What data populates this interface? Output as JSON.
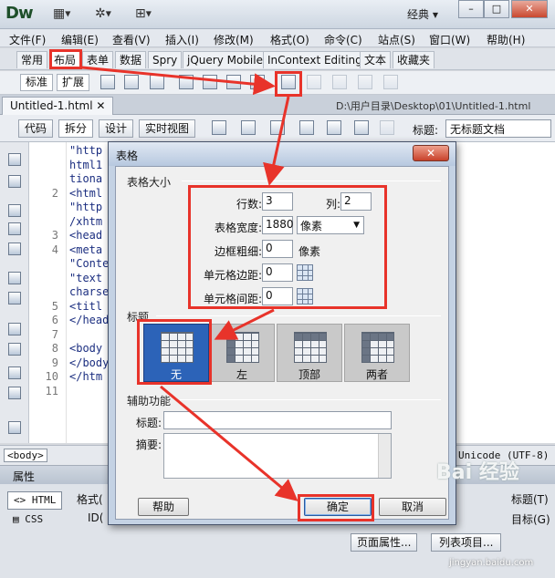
{
  "app": {
    "logo": "Dw",
    "workspace": "经典",
    "window_controls": [
      "–",
      "□",
      "✕"
    ]
  },
  "menu": [
    "文件(F)",
    "编辑(E)",
    "查看(V)",
    "插入(I)",
    "修改(M)",
    "格式(O)",
    "命令(C)",
    "站点(S)",
    "窗口(W)",
    "帮助(H)"
  ],
  "insert_tabs": [
    "常用",
    "布局",
    "表单",
    "数据",
    "Spry",
    "jQuery Mobile",
    "InContext Editing",
    "文本",
    "收藏夹"
  ],
  "insert_tools": {
    "standard": "标准",
    "expanded": "扩展"
  },
  "document": {
    "tab": "Untitled-1.html",
    "path": "D:\\用户目录\\Desktop\\01\\Untitled-1.html",
    "view_buttons": [
      "代码",
      "拆分",
      "设计",
      "实时视图"
    ],
    "title_label": "标题:",
    "title_value": "无标题文档"
  },
  "code": {
    "lines": [
      {
        "num": "",
        "text": "\"http"
      },
      {
        "num": "",
        "text": "html1"
      },
      {
        "num": "",
        "text": "tiona"
      },
      {
        "num": "2",
        "text": "<html"
      },
      {
        "num": "",
        "text": "\"http"
      },
      {
        "num": "",
        "text": "/xhtm"
      },
      {
        "num": "3",
        "text": "<head"
      },
      {
        "num": "4",
        "text": "<meta"
      },
      {
        "num": "",
        "text": "\"Conte"
      },
      {
        "num": "",
        "text": "\"text"
      },
      {
        "num": "",
        "text": "charse"
      },
      {
        "num": "5",
        "text": "<titl"
      },
      {
        "num": "6",
        "text": "</head"
      },
      {
        "num": "7",
        "text": ""
      },
      {
        "num": "8",
        "text": "<body"
      },
      {
        "num": "9",
        "text": "</body"
      },
      {
        "num": "10",
        "text": "</htm"
      },
      {
        "num": "11",
        "text": ""
      }
    ]
  },
  "status": {
    "tag": "<body>",
    "encoding": "Unicode (UTF-8)"
  },
  "properties": {
    "title": "属性",
    "html_btn": "HTML",
    "css_btn": "CSS",
    "format_label": "格式(",
    "id_label": "ID(",
    "title_label": "标题(T)",
    "target_label": "目标(G)",
    "page_props_btn": "页面属性...",
    "list_items_btn": "列表项目..."
  },
  "dialog": {
    "title": "表格",
    "close": "✕",
    "size_section": "表格大小",
    "rows_label": "行数:",
    "rows_value": "3",
    "cols_label": "列:",
    "cols_value": "2",
    "width_label": "表格宽度:",
    "width_value": "1880",
    "width_unit": "像素",
    "border_label": "边框粗细:",
    "border_value": "0",
    "border_unit": "像素",
    "padding_label": "单元格边距:",
    "padding_value": "0",
    "spacing_label": "单元格间距:",
    "spacing_value": "0",
    "header_section": "标题",
    "header_options": [
      "无",
      "左",
      "顶部",
      "两者"
    ],
    "access_section": "辅助功能",
    "caption_label": "标题:",
    "caption_value": "",
    "summary_label": "摘要:",
    "help_btn": "帮助",
    "ok_btn": "确定",
    "cancel_btn": "取消"
  },
  "watermark": {
    "text": "Bai 经验",
    "url": "jingyan.baidu.com"
  },
  "colors": {
    "highlight": "#e8332a",
    "selected_header": "#2c63b8",
    "dialog_frame": "#c4d2e4"
  }
}
